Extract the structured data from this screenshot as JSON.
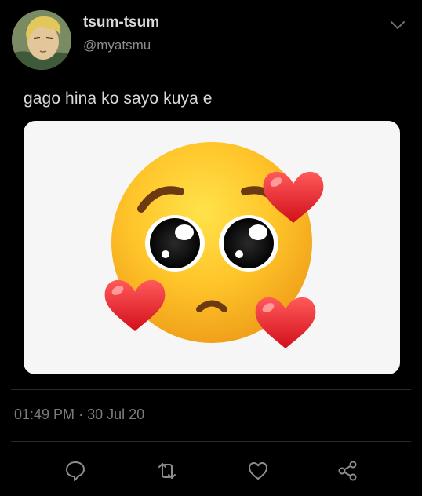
{
  "tweet": {
    "display_name": "tsum-tsum",
    "handle": "@myatsmu",
    "text": "gago hina ko sayo kuya e",
    "time": "01:49 PM",
    "separator": "·",
    "date": "30 Jul 20"
  },
  "icons": {
    "menu": "chevron-down-icon",
    "reply": "reply-icon",
    "retweet": "retweet-icon",
    "like": "heart-icon",
    "share": "share-icon"
  },
  "colors": {
    "background": "#000000",
    "text": "#d9d9d9",
    "secondary": "#7c7c7c",
    "divider": "#2a2a2a",
    "icon": "#8d8d8d"
  }
}
